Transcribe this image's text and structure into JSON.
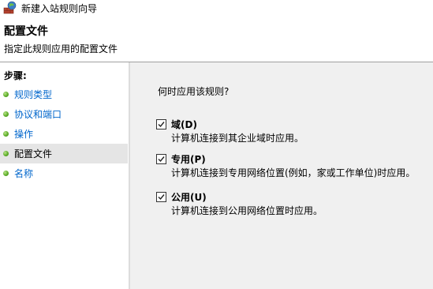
{
  "window": {
    "title": "新建入站规则向导",
    "icon": "firewall-icon"
  },
  "header": {
    "title": "配置文件",
    "subtitle": "指定此规则应用的配置文件"
  },
  "steps": {
    "title": "步骤:",
    "items": [
      {
        "label": "规则类型",
        "active": false
      },
      {
        "label": "协议和端口",
        "active": false
      },
      {
        "label": "操作",
        "active": false
      },
      {
        "label": "配置文件",
        "active": true
      },
      {
        "label": "名称",
        "active": false
      }
    ]
  },
  "main": {
    "question": "何时应用该规则?",
    "options": [
      {
        "label": "域(D)",
        "description": "计算机连接到其企业域时应用。",
        "checked": true
      },
      {
        "label": "专用(P)",
        "description": "计算机连接到专用网络位置(例如，家或工作单位)时应用。",
        "checked": true
      },
      {
        "label": "公用(U)",
        "description": "计算机连接到公用网络位置时应用。",
        "checked": true
      }
    ]
  },
  "colors": {
    "link": "#0066cc",
    "active_step_bg": "#e5e5e5",
    "content_bg": "#f0f0f0",
    "step_dot": "#5fae2a"
  }
}
